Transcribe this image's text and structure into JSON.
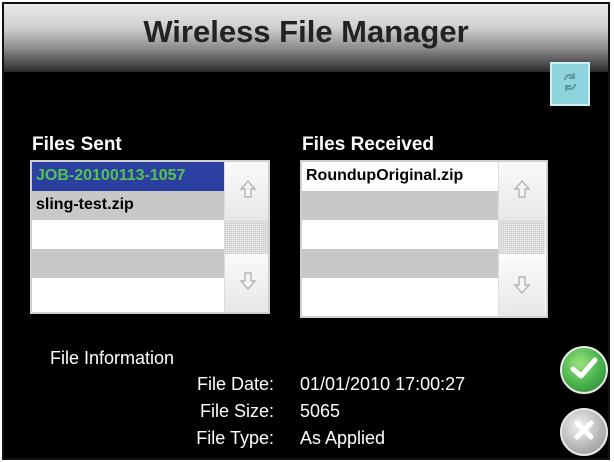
{
  "window": {
    "title": "Wireless File Manager"
  },
  "buttons": {
    "refresh_icon": "refresh-icon",
    "ok_icon": "check-icon",
    "cancel_icon": "close-icon"
  },
  "files_sent": {
    "label": "Files Sent",
    "items": [
      "JOB-20100113-1057",
      "sling-test.zip",
      "",
      "",
      ""
    ]
  },
  "files_received": {
    "label": "Files Received",
    "items": [
      "RoundupOriginal.zip",
      "",
      "",
      "",
      ""
    ]
  },
  "file_info": {
    "heading": "File Information",
    "date_label": "File Date:",
    "date_value": "01/01/2010 17:00:27",
    "size_label": "File Size:",
    "size_value": "5065",
    "type_label": "File Type:",
    "type_value": "As Applied"
  },
  "colors": {
    "selection": "#2b3fa0",
    "selection_text": "#55c34e",
    "refresh_button": "#8fd3dc"
  }
}
